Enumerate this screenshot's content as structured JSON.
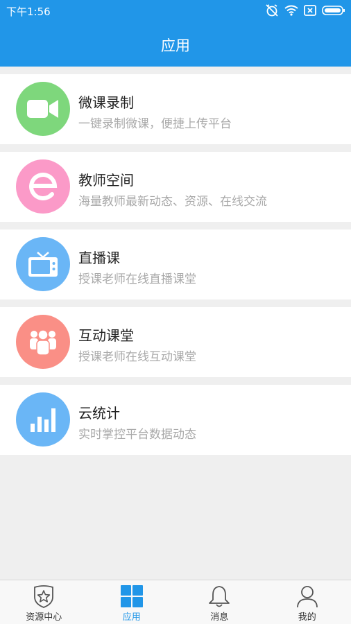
{
  "status_bar": {
    "time": "下午1:56"
  },
  "header": {
    "title": "应用"
  },
  "apps": [
    {
      "title": "微课录制",
      "subtitle": "一键录制微课，便捷上传平台",
      "icon": "video-camera-icon",
      "color": "#7ed77c"
    },
    {
      "title": "教师空间",
      "subtitle": "海量教师最新动态、资源、在线交流",
      "icon": "letter-e-icon",
      "color": "#fb9ac8"
    },
    {
      "title": "直播课",
      "subtitle": "授课老师在线直播课堂",
      "icon": "tv-icon",
      "color": "#6ab6f6"
    },
    {
      "title": "互动课堂",
      "subtitle": "授课老师在线互动课堂",
      "icon": "group-icon",
      "color": "#fa8f86"
    },
    {
      "title": "云统计",
      "subtitle": "实时掌控平台数据动态",
      "icon": "bar-chart-icon",
      "color": "#6ab6f6"
    }
  ],
  "tabs": [
    {
      "label": "资源中心",
      "icon": "star-shield-icon",
      "active": false
    },
    {
      "label": "应用",
      "icon": "grid-icon",
      "active": true
    },
    {
      "label": "消息",
      "icon": "bell-icon",
      "active": false
    },
    {
      "label": "我的",
      "icon": "person-icon",
      "active": false
    }
  ],
  "colors": {
    "primary": "#2196e8",
    "background": "#efefef",
    "subtitle": "#a9a9a9"
  }
}
